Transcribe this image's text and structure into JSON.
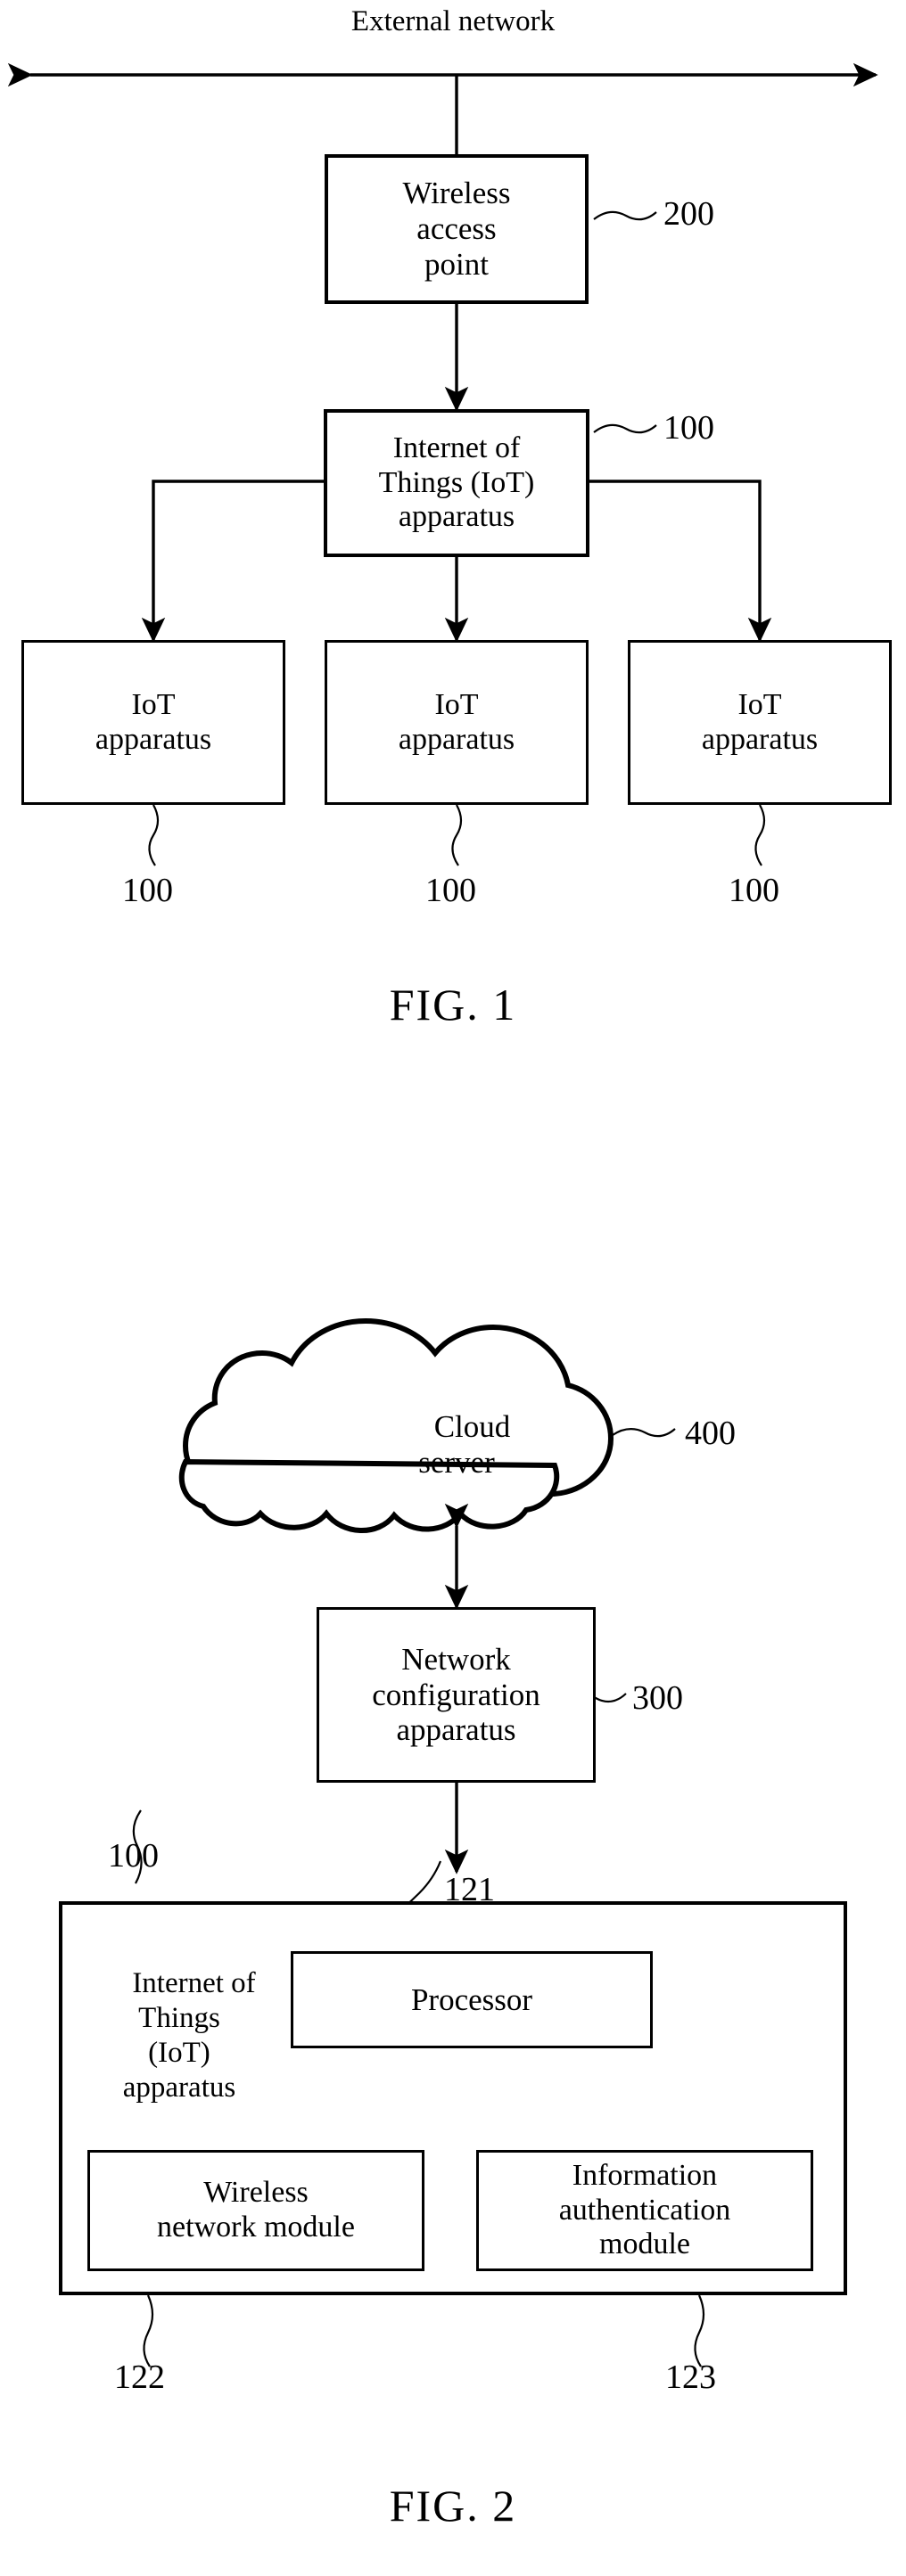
{
  "document": {
    "type": "patent-drawing-sheet",
    "figures": [
      {
        "caption": "FIG. 1",
        "title_label": "External network",
        "nodes": [
          {
            "id": "wap",
            "label": "Wireless\naccess\npoint",
            "ref": "200"
          },
          {
            "id": "iot_main",
            "label": "Internet of\nThings (IoT)\napparatus",
            "ref": "100"
          },
          {
            "id": "iot_left",
            "label": "IoT\napparatus",
            "ref": "100"
          },
          {
            "id": "iot_center",
            "label": "IoT\napparatus",
            "ref": "100"
          },
          {
            "id": "iot_right",
            "label": "IoT\napparatus",
            "ref": "100"
          }
        ]
      },
      {
        "caption": "FIG. 2",
        "nodes": [
          {
            "id": "cloud",
            "label": "Cloud\nserver",
            "ref": "400"
          },
          {
            "id": "netcfg",
            "label": "Network\nconfiguration\napparatus",
            "ref": "300"
          },
          {
            "id": "iot_container",
            "label": "Internet of\nThings\n(IoT)\napparatus",
            "ref": "100"
          },
          {
            "id": "processor",
            "label": "Processor",
            "ref": "121"
          },
          {
            "id": "wireless_mod",
            "label": "Wireless\nnetwork module",
            "ref": "122"
          },
          {
            "id": "auth_mod",
            "label": "Information\nauthentication\nmodule",
            "ref": "123"
          }
        ]
      }
    ]
  },
  "fig1": {
    "external_network": "External network",
    "wireless_access_point": "Wireless\naccess\npoint",
    "wireless_access_point_ref": "200",
    "iot_main": "Internet of\nThings (IoT)\napparatus",
    "iot_main_ref": "100",
    "iot_left": "IoT\napparatus",
    "iot_center": "IoT\napparatus",
    "iot_right": "IoT\napparatus",
    "iot_left_ref": "100",
    "iot_center_ref": "100",
    "iot_right_ref": "100",
    "caption": "FIG. 1"
  },
  "fig2": {
    "cloud_server": "Cloud\nserver",
    "cloud_server_ref": "400",
    "network_configuration_apparatus": "Network\nconfiguration\napparatus",
    "network_configuration_apparatus_ref": "300",
    "iot_apparatus": "Internet of\nThings\n(IoT)\napparatus",
    "iot_apparatus_ref": "100",
    "processor": "Processor",
    "processor_ref": "121",
    "wireless_network_module": "Wireless\nnetwork module",
    "wireless_network_module_ref": "122",
    "information_authentication_module": "Information\nauthentication\nmodule",
    "information_authentication_module_ref": "123",
    "caption": "FIG. 2"
  },
  "colors": {
    "ink": "#000000",
    "paper": "#ffffff"
  }
}
